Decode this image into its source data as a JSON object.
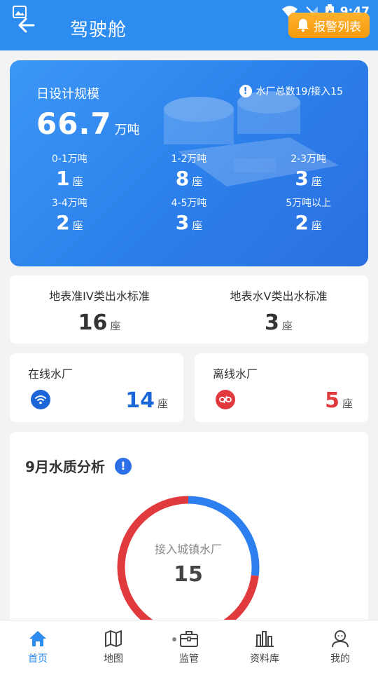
{
  "status_bar": {
    "time": "9:47"
  },
  "header": {
    "title": "驾驶舱",
    "alarm_label": "报警列表"
  },
  "capacity": {
    "label": "日设计规模",
    "total_value": "66.7",
    "total_unit": "万吨",
    "info_text": "水厂总数19/接入15",
    "unit_count": "座",
    "ranges": [
      {
        "label": "0-1万吨",
        "count": "1"
      },
      {
        "label": "1-2万吨",
        "count": "8"
      },
      {
        "label": "2-3万吨",
        "count": "3"
      },
      {
        "label": "3-4万吨",
        "count": "2"
      },
      {
        "label": "4-5万吨",
        "count": "3"
      },
      {
        "label": "5万吨以上",
        "count": "2"
      }
    ]
  },
  "standards": [
    {
      "label": "地表准IV类出水标准",
      "count": "16",
      "unit": "座"
    },
    {
      "label": "地表水V类出水标准",
      "count": "3",
      "unit": "座"
    }
  ],
  "plants": {
    "online": {
      "label": "在线水厂",
      "count": "14",
      "unit": "座",
      "color": "#1d66d8"
    },
    "offline": {
      "label": "离线水厂",
      "count": "5",
      "unit": "座",
      "color": "#e0393e"
    }
  },
  "quality": {
    "title": "9月水质分析",
    "donut_label": "接入城镇水厂",
    "donut_value": "15",
    "segments": [
      {
        "color": "#2d7ff0",
        "fraction": 0.27
      },
      {
        "color": "#e0393e",
        "fraction": 0.73
      }
    ]
  },
  "nav": [
    {
      "label": "首页",
      "icon": "home-icon",
      "active": true
    },
    {
      "label": "地图",
      "icon": "map-icon",
      "active": false
    },
    {
      "label": "监管",
      "icon": "briefcase-icon",
      "active": false
    },
    {
      "label": "资料库",
      "icon": "library-icon",
      "active": false
    },
    {
      "label": "我的",
      "icon": "user-icon",
      "active": false
    }
  ]
}
